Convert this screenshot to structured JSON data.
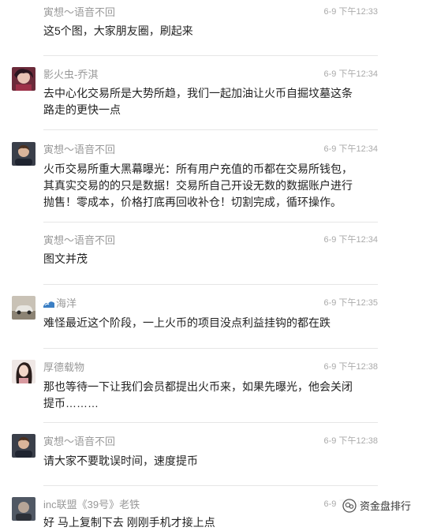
{
  "comments": [
    {
      "name": "寅想～语音不回",
      "time": "6-9 下午12:33",
      "text": "这5个图，大家朋友圈，刷起来",
      "avatar": "none"
    },
    {
      "name": "影火虫-乔淇",
      "time": "6-9 下午12:34",
      "text": "去中心化交易所是大势所趋，我们一起加油让火币自掘坟墓这条路走的更快一点",
      "avatar": "anime-avatar"
    },
    {
      "name": "寅想～语音不回",
      "time": "6-9 下午12:34",
      "text": "火币交易所重大黑幕曝光：所有用户充值的币都在交易所钱包，其真实交易的的只是数据！交易所自己开设无数的数据账户进行抛售！零成本，价格打底再回收补仓！切割完成，循环操作。",
      "avatar": "man-avatar"
    },
    {
      "name": "寅想～语音不回",
      "time": "6-9 下午12:34",
      "text": "图文并茂",
      "avatar": "none"
    },
    {
      "name": "海洋",
      "time": "6-9 下午12:35",
      "text": "难怪最近这个阶段，一上火币的项目没点利益挂钩的都在跌",
      "avatar": "car-avatar"
    },
    {
      "name": "厚德载物",
      "time": "6-9 下午12:38",
      "text": "那也等待一下让我们会员都提出火币来，如果先曝光，他会关闭提币………",
      "avatar": "woman-avatar"
    },
    {
      "name": "寅想～语音不回",
      "time": "6-9 下午12:38",
      "text": "请大家不要耽误时间，速度提币",
      "avatar": "man-avatar"
    },
    {
      "name": "inc联盟《39号》老铁",
      "time": "6-9 下午12:38",
      "text": "好 马上复制下去 刚刚手机才接上点",
      "avatar": "dark-avatar"
    }
  ],
  "watermark": {
    "label": "资金盘排行",
    "icon": "wechat-official-account-icon"
  }
}
